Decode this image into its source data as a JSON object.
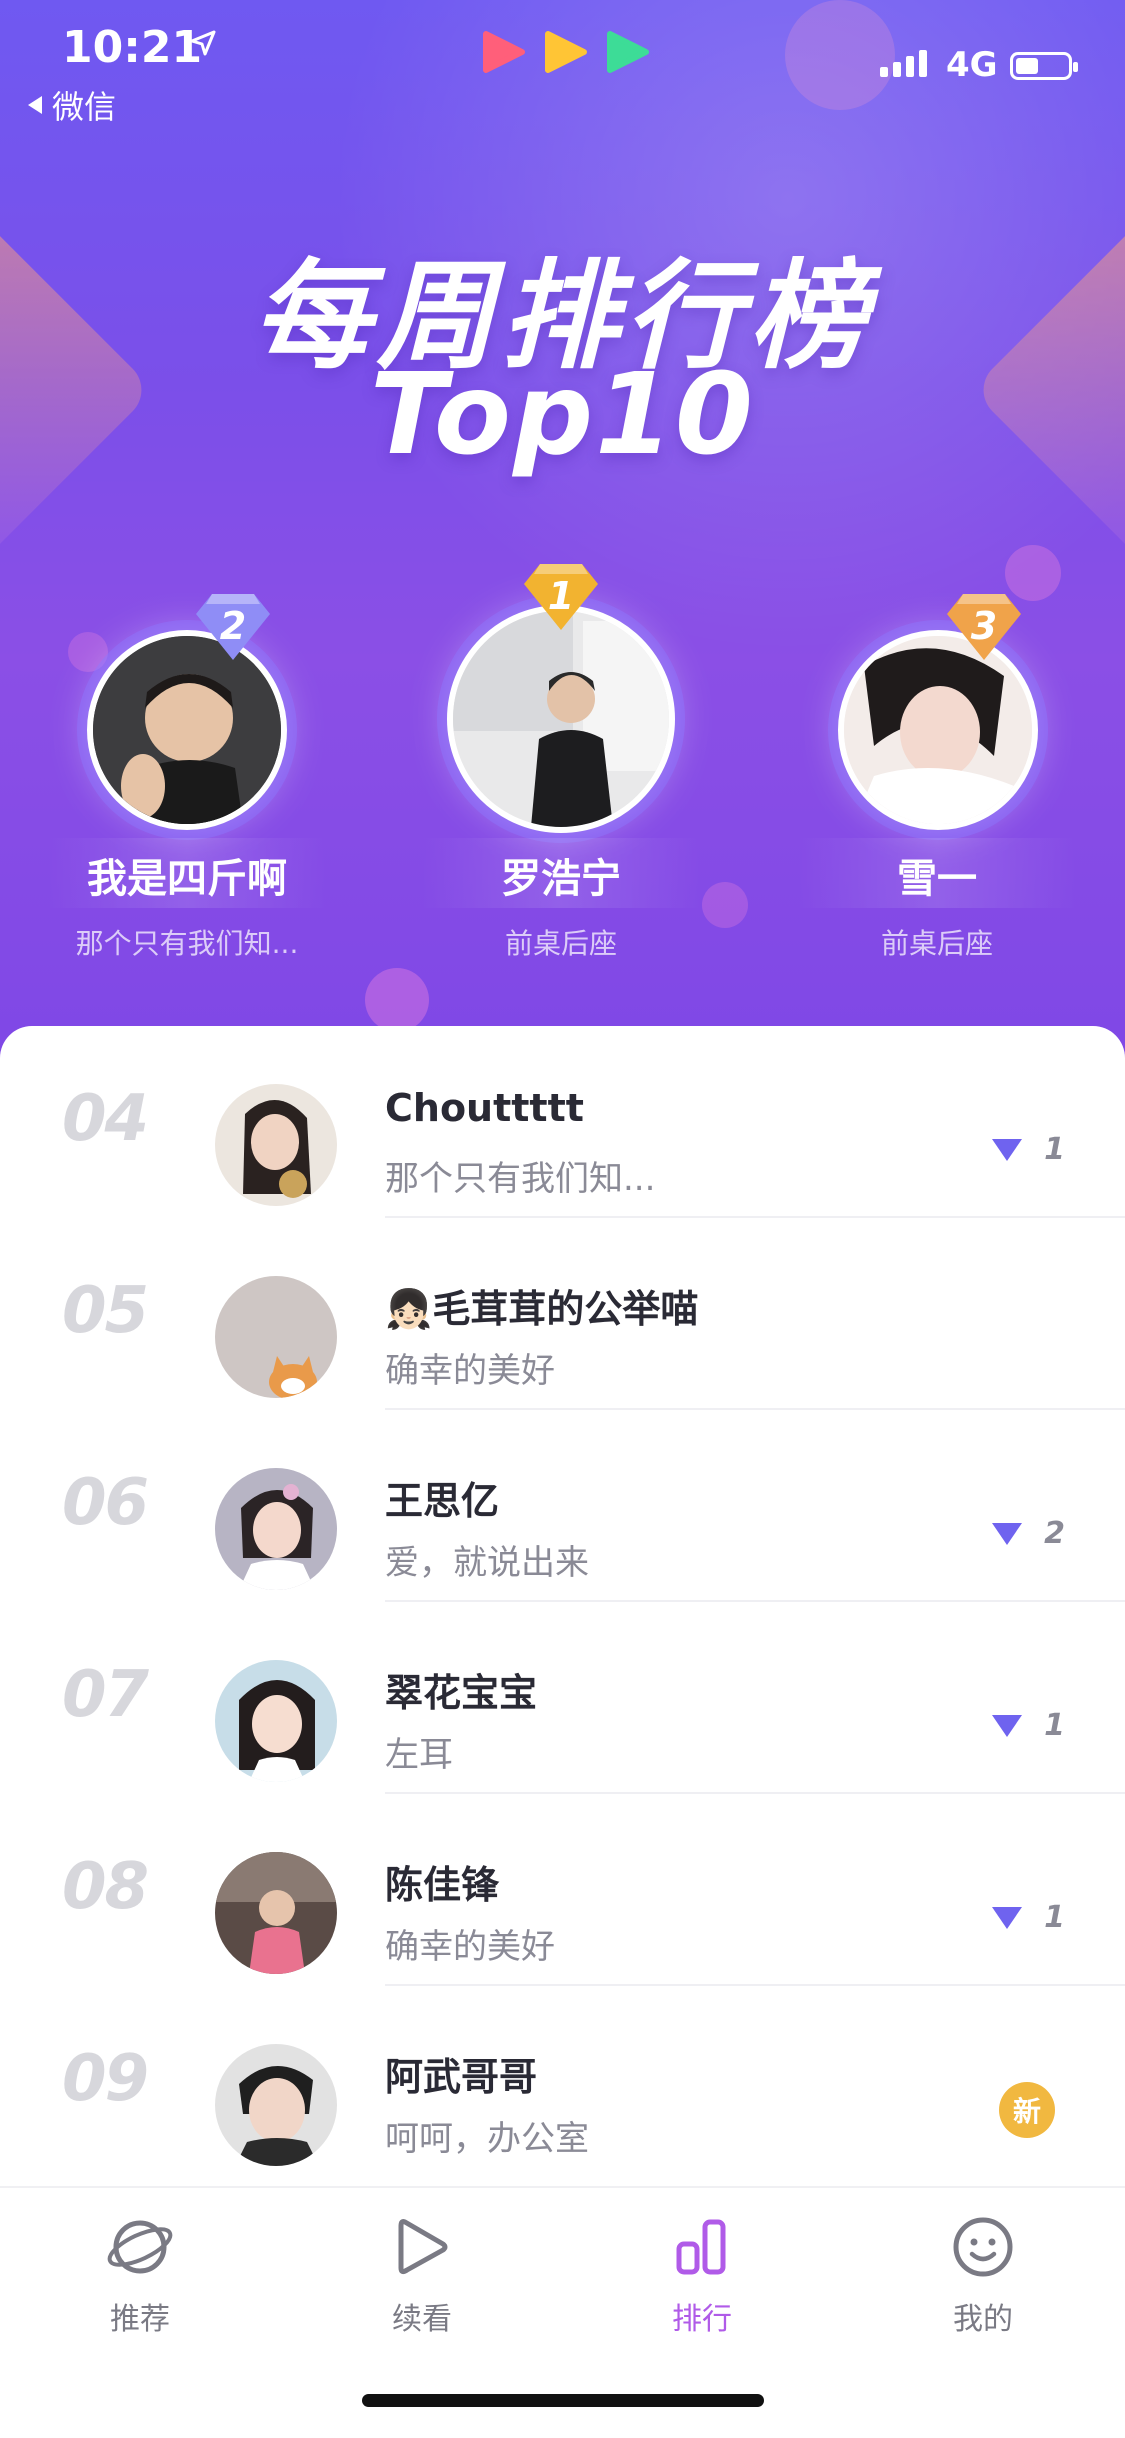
{
  "status_bar": {
    "time": "10:21",
    "back_label": "微信",
    "network": "4G"
  },
  "hero": {
    "title": "每周排行榜",
    "subtitle": "Top10"
  },
  "podium": [
    {
      "rank": "1",
      "name": "罗浩宁",
      "desc": "前桌后座",
      "badge_color": "#f2b330"
    },
    {
      "rank": "2",
      "name": "我是四斤啊",
      "desc": "那个只有我们知...",
      "badge_color": "#8f8df6"
    },
    {
      "rank": "3",
      "name": "雪一",
      "desc": "前桌后座",
      "badge_color": "#f0a34a"
    }
  ],
  "list": [
    {
      "rank": "04",
      "title": "Chouttttt",
      "subtitle": "那个只有我们知...",
      "trend": "1",
      "is_new": false
    },
    {
      "rank": "05",
      "title": "👧🏻毛茸茸的公举喵",
      "subtitle": "确幸的美好",
      "trend": "",
      "is_new": false
    },
    {
      "rank": "06",
      "title": "王思亿",
      "subtitle": "爱，就说出来",
      "trend": "2",
      "is_new": false
    },
    {
      "rank": "07",
      "title": "翠花宝宝",
      "subtitle": "左耳",
      "trend": "1",
      "is_new": false
    },
    {
      "rank": "08",
      "title": "陈佳锋",
      "subtitle": "确幸的美好",
      "trend": "1",
      "is_new": false
    },
    {
      "rank": "09",
      "title": "阿武哥哥",
      "subtitle": "呵呵，办公室",
      "trend": "",
      "is_new": true,
      "new_label": "新"
    }
  ],
  "tabbar": {
    "items": [
      {
        "label": "推荐",
        "icon": "planet-icon"
      },
      {
        "label": "续看",
        "icon": "play-icon"
      },
      {
        "label": "排行",
        "icon": "ranking-icon",
        "active": true
      },
      {
        "label": "我的",
        "icon": "smiley-icon"
      }
    ]
  },
  "colors": {
    "accent": "#6f63ef",
    "active_tab": "#b05be8",
    "new_badge": "#f1b840"
  }
}
